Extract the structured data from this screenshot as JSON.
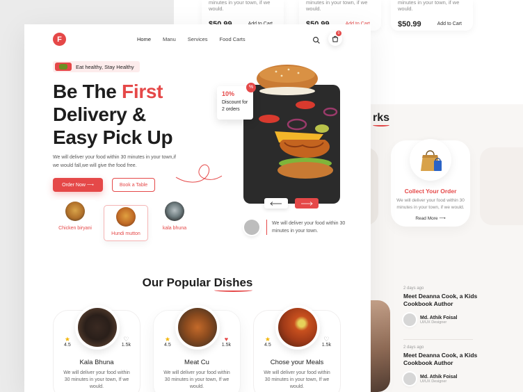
{
  "background": {
    "products": [
      {
        "desc": "minutes in your town, if we would.",
        "price": "$50.99",
        "cart_label": "Add to Cart",
        "active": false
      },
      {
        "desc": "minutes in your town, if we would.",
        "price": "$50.99",
        "cart_label": "Add to Cart",
        "active": true
      },
      {
        "desc": "minutes in your town, if we would.",
        "price": "$50.99",
        "cart_label": "Add to Cart",
        "active": false
      }
    ],
    "works_title": "rks",
    "step": {
      "title": "Collect Your Order",
      "desc": "We will deliver your food within 30 minutes in your town, if we would.",
      "more": "Read More"
    },
    "blogs": [
      {
        "date": "2 days ago",
        "title": "Meet Deanna Cook, a Kids Cookbook Author",
        "author": "Md. Athik Foisal",
        "role": "UI/UX Designer"
      },
      {
        "date": "2 days ago",
        "title": "Meet Deanna Cook, a Kids Cookbook Author",
        "author": "Md. Athik Foisal",
        "role": "UI/UX Designer"
      }
    ]
  },
  "nav": {
    "logo": "F",
    "links": [
      "Home",
      "Manu",
      "Services",
      "Food Carts"
    ],
    "cart_count": "0"
  },
  "hero": {
    "tag": "Eat healthy, Stay Healthy",
    "title_part1": "Be The ",
    "title_highlight": "First",
    "title_line2": "Delivery &",
    "title_line3": "Easy Pick Up",
    "desc": "We will deliver your food within 30 minutes in your town,if we would fall,we will give the food free.",
    "primary_btn": "Order Now",
    "secondary_btn": "Book a Table",
    "mini_dishes": [
      "Chicken biryani",
      "Hundi mutton",
      "kala bhuna"
    ],
    "discount_pct": "10%",
    "discount_text": "Discount for 2 orders",
    "pct_badge": "%",
    "deliver_text": "We will deliver your food within 30 minutes in your town."
  },
  "popular": {
    "title_part1": "Our Popular ",
    "title_underlined": "Dishes",
    "dishes": [
      {
        "name": "Kala Bhuna",
        "rating": "4.5",
        "likes": "1.5k",
        "liked": false,
        "desc": "We will deliver your food within 30 minutes in your town, If we would."
      },
      {
        "name": "Meat Cu",
        "rating": "4.5",
        "likes": "1.5k",
        "liked": true,
        "desc": "We will deliver your food within 30 minutes in your town, If we would."
      },
      {
        "name": "Chose your Meals",
        "rating": "4.5",
        "likes": "1.5k",
        "liked": false,
        "desc": "We will deliver your food within 30 minutes in your town, If we would."
      }
    ]
  },
  "colors": {
    "accent": "#e54848",
    "dark": "#2b2b2b",
    "star": "#f2b400"
  }
}
